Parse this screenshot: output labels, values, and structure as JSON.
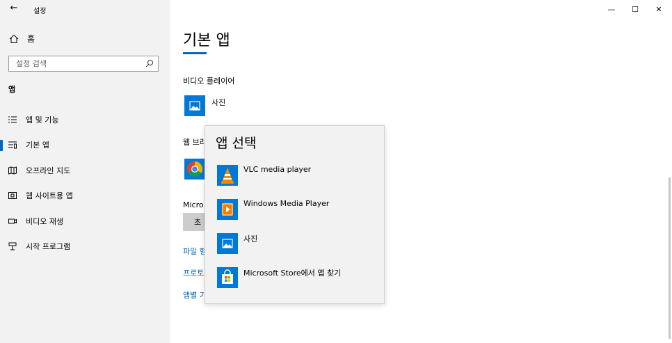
{
  "window": {
    "title": "설정",
    "back": "←",
    "minimize": "—",
    "maximize": "☐",
    "close": "✕"
  },
  "sidebar": {
    "home_label": "홈",
    "search_placeholder": "설정 검색",
    "section": "앱",
    "items": [
      {
        "label": "앱 및 기능",
        "icon": "apps-features-icon"
      },
      {
        "label": "기본 앱",
        "icon": "default-apps-icon",
        "selected": true
      },
      {
        "label": "오프라인 지도",
        "icon": "offline-maps-icon"
      },
      {
        "label": "웹 사이트용 앱",
        "icon": "apps-for-websites-icon"
      },
      {
        "label": "비디오 재생",
        "icon": "video-playback-icon"
      },
      {
        "label": "시작 프로그램",
        "icon": "startup-icon"
      }
    ]
  },
  "main": {
    "title": "기본 앱",
    "video_player_label": "비디오 플레이어",
    "video_player_app": "사진",
    "web_browser_label": "웹 브라",
    "microsoft_label": "Micro",
    "reset_button": "초",
    "links": [
      "파일 형",
      "프로토",
      "앱별 기"
    ]
  },
  "flyout": {
    "title": "앱 선택",
    "items": [
      {
        "label": "VLC media player",
        "icon": "vlc-icon"
      },
      {
        "label": "Windows Media Player",
        "icon": "windows-media-player-icon"
      },
      {
        "label": "사진",
        "icon": "photos-icon"
      },
      {
        "label": "Microsoft Store에서 앱 찾기",
        "icon": "microsoft-store-icon"
      }
    ]
  },
  "colors": {
    "accent": "#0067c0",
    "sidebar_bg": "#f2f2f2",
    "link": "#0063b1",
    "photos_tile": "#0078d7"
  }
}
